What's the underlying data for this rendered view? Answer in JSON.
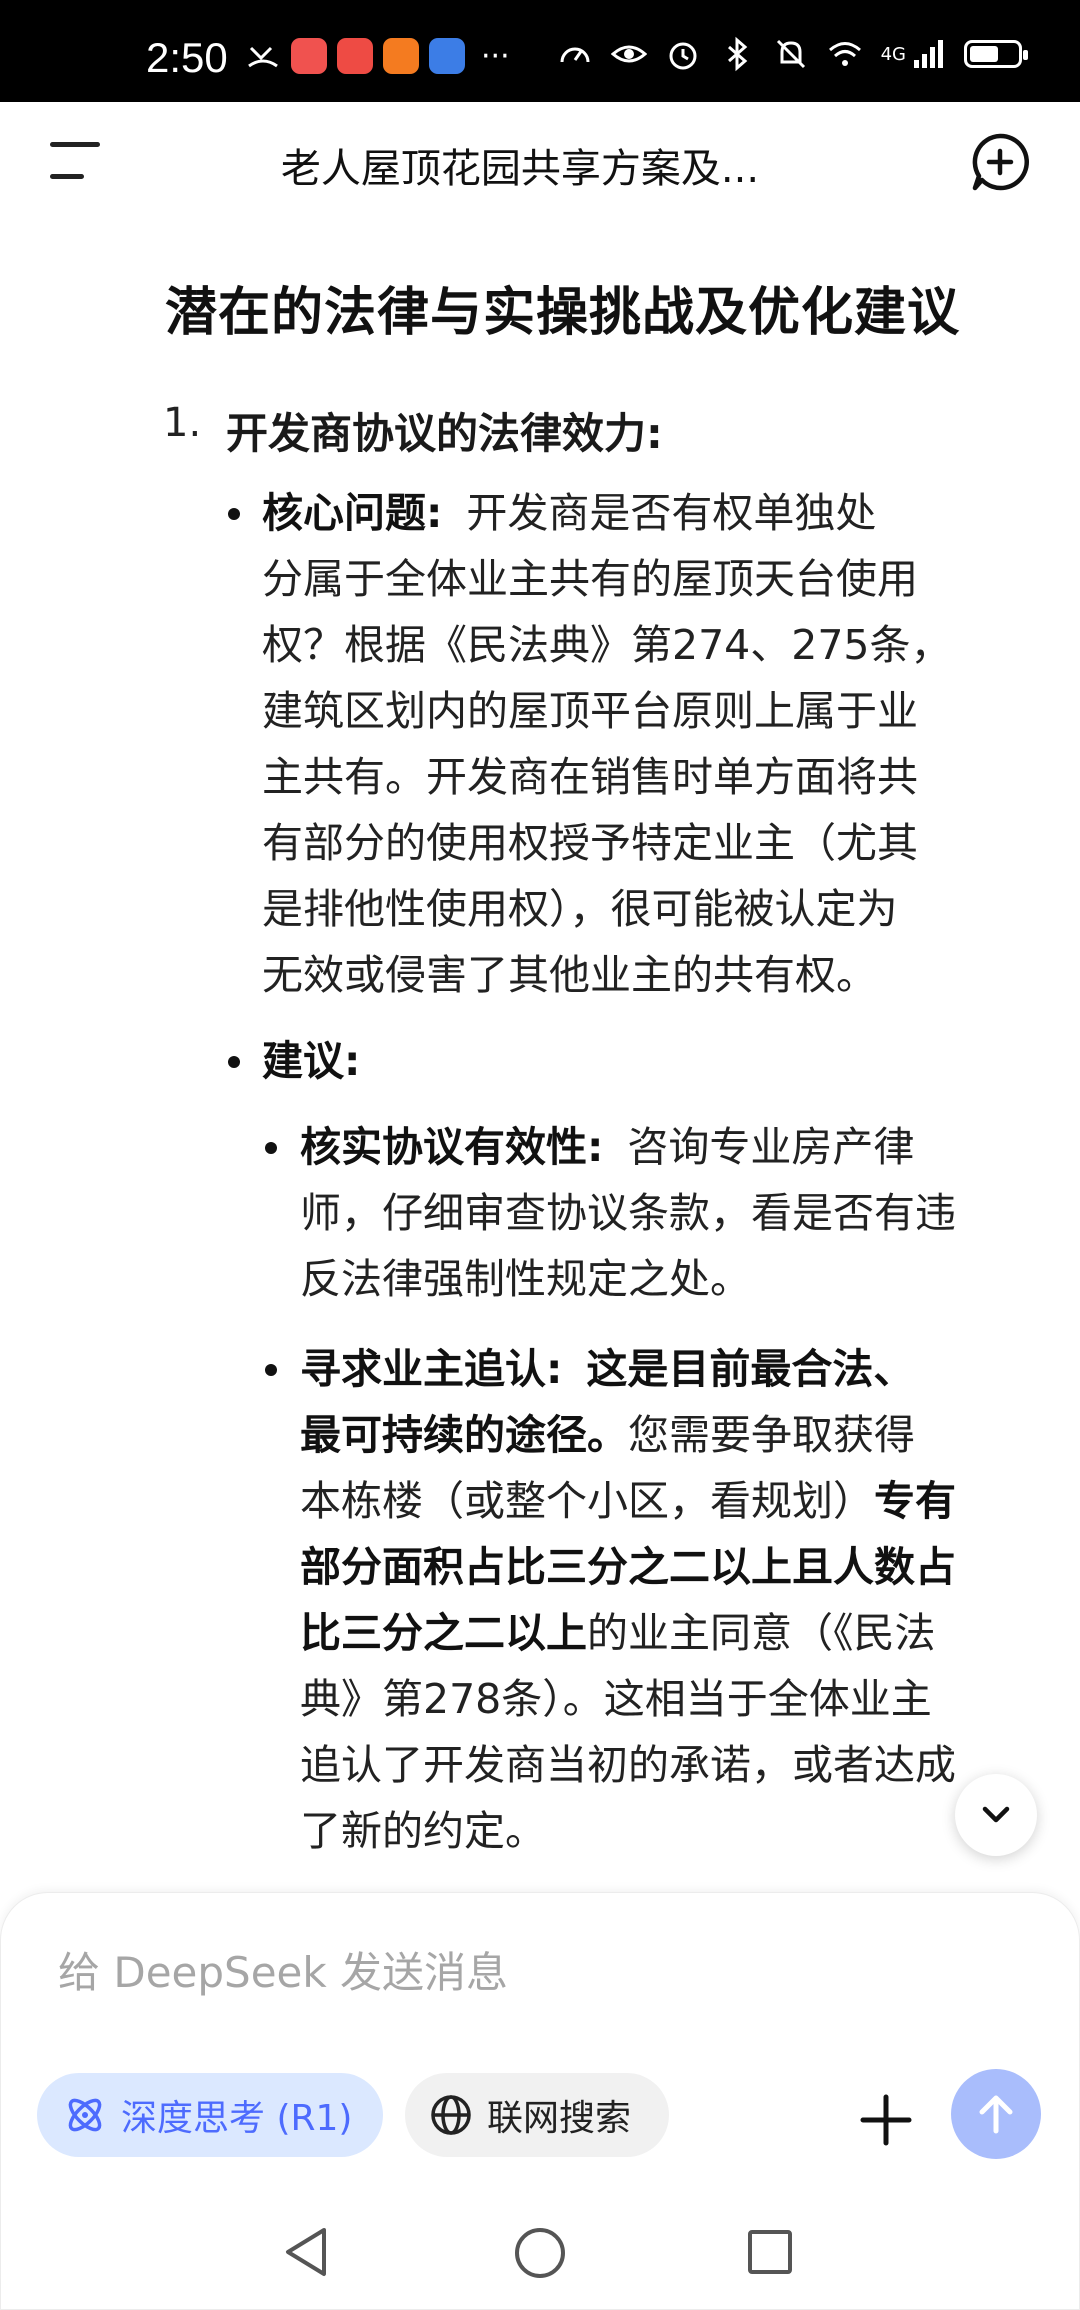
{
  "status_bar": {
    "time": "2:50",
    "more": "···",
    "network": "4G",
    "battery_level": 0.6,
    "app_icon_colors": [
      "#f0524f",
      "#ee4b44",
      "#f47b20",
      "#3c7de6"
    ]
  },
  "header": {
    "title": "老人屋顶花园共享方案及...",
    "menu_icon": "menu-icon",
    "new_chat_icon": "new-chat-icon"
  },
  "content": {
    "section_heading": "潜在的法律与实操挑战及优化建议",
    "item_number": "1.",
    "item_title": "开发商协议的法律效力:",
    "core_issue": {
      "label": "核心问题:",
      "lines": [
        "开发商是否有权单独处",
        "分属于全体业主共有的屋顶天台使用",
        "权？根据《民法典》第274、275条，",
        "建筑区划内的屋顶平台原则上属于业",
        "主共有。开发商在销售时单方面将共",
        "有部分的使用权授予特定业主（尤其",
        "是排他性使用权），很可能被认定为",
        "无效或侵害了其他业主的共有权。"
      ]
    },
    "suggestion_label": "建议:",
    "verify": {
      "label": "核实协议有效性:",
      "lines": [
        "咨询专业房产律",
        "师，仔细审查协议条款，看是否有违",
        "反法律强制性规定之处。"
      ]
    },
    "ratify": {
      "label": "寻求业主追认:",
      "bold1": "这是目前最合法、",
      "bold2": "最可持续的途径。",
      "text1": "您需要争取获得",
      "text2": "本栋楼（或整个小区，看规划）",
      "bold3": "专有",
      "bold4": "部分面积占比三分之二以上且人数占",
      "bold5": "比三分之二以上",
      "text3": "的业主同意（《民法",
      "text4": "典》第278条）。这相当于全体业主",
      "text5": "追认了开发商当初的承诺，或者达成",
      "text6": "了新的约定。"
    }
  },
  "composer": {
    "placeholder": "给 DeepSeek 发送消息",
    "deep_think_label": "深度思考 (R1)",
    "web_search_label": "联网搜索",
    "accent_color": "#4d6bfe",
    "send_color": "#a9bdfc"
  }
}
